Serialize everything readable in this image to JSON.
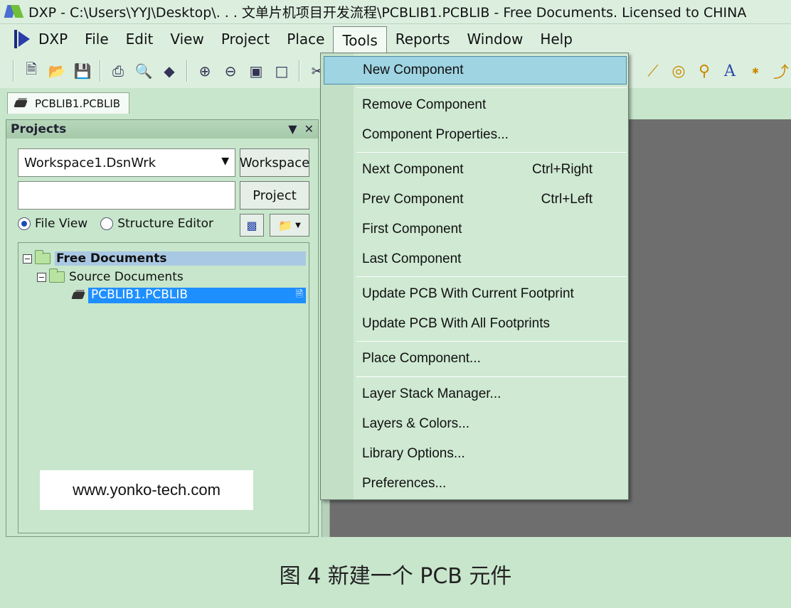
{
  "window": {
    "title": "DXP - C:\\Users\\YYJ\\Desktop\\. . . 文单片机项目开发流程\\PCBLIB1.PCBLIB - Free Documents. Licensed to CHINA"
  },
  "menubar": {
    "items": [
      {
        "label": "DXP"
      },
      {
        "label": "File"
      },
      {
        "label": "Edit"
      },
      {
        "label": "View"
      },
      {
        "label": "Project"
      },
      {
        "label": "Place"
      },
      {
        "label": "Tools"
      },
      {
        "label": "Reports"
      },
      {
        "label": "Window"
      },
      {
        "label": "Help"
      }
    ],
    "active": "Tools"
  },
  "toolbar": {
    "icons": [
      "new-document-icon",
      "open-folder-icon",
      "save-icon",
      "print-icon",
      "print-preview-icon",
      "3d-view-icon",
      "zoom-in-icon",
      "zoom-out-icon",
      "zoom-fit-icon",
      "zoom-selection-icon",
      "cut-icon",
      "line-icon",
      "pad-icon",
      "via-icon",
      "text-icon",
      "string-icon",
      "arc-icon"
    ],
    "text_glyph": "A"
  },
  "document_tab": {
    "label": "PCBLIB1.PCBLIB"
  },
  "projects_panel": {
    "title": "Projects",
    "workspace_value": "Workspace1.DsnWrk",
    "workspace_button": "Workspace",
    "project_field_value": "",
    "project_button": "Project",
    "view_options": [
      {
        "label": "File View",
        "selected": true
      },
      {
        "label": "Structure Editor",
        "selected": false
      }
    ],
    "tree": {
      "root": "Free Documents",
      "group": "Source Documents",
      "file": "PCBLIB1.PCBLIB"
    }
  },
  "watermark": {
    "text": "www.yonko-tech.com"
  },
  "tools_menu": {
    "items": [
      {
        "label": "New Component",
        "shortcut": ""
      },
      {
        "label": "Remove Component",
        "shortcut": ""
      },
      {
        "label": "Component Properties...",
        "shortcut": ""
      },
      {
        "label": "Next Component",
        "shortcut": "Ctrl+Right"
      },
      {
        "label": "Prev Component",
        "shortcut": "Ctrl+Left"
      },
      {
        "label": "First Component",
        "shortcut": ""
      },
      {
        "label": "Last Component",
        "shortcut": ""
      },
      {
        "label": "Update PCB With Current Footprint",
        "shortcut": ""
      },
      {
        "label": "Update PCB With All Footprints",
        "shortcut": ""
      },
      {
        "label": "Place Component...",
        "shortcut": ""
      },
      {
        "label": "Layer Stack Manager...",
        "shortcut": ""
      },
      {
        "label": "Layers & Colors...",
        "shortcut": ""
      },
      {
        "label": "Library Options...",
        "shortcut": ""
      },
      {
        "label": "Preferences...",
        "shortcut": ""
      }
    ],
    "highlighted": "New Component"
  },
  "caption": {
    "text": "图 4  新建一个 PCB 元件"
  },
  "colors": {
    "background": "#c8e6cc",
    "menu_highlight": "#9fd4e3",
    "selection_blue": "#1e8fff",
    "workspace_gray": "#6e6e6e"
  }
}
